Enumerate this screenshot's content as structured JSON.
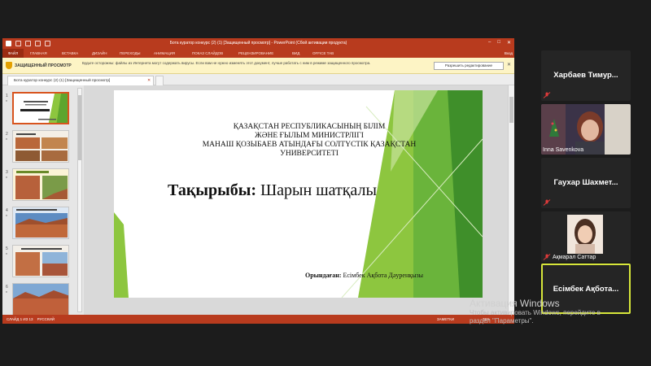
{
  "window": {
    "title": "Бота куратор конкурс (2) (1) [Защищенный просмотр] - PowerPoint (Сбой активации продукта)",
    "file_tab": "ФАЙЛ",
    "tabs": [
      "ГЛАВНАЯ",
      "ВСТАВКА",
      "ДИЗАЙН",
      "ПЕРЕХОДЫ",
      "АНИМАЦИЯ",
      "ПОКАЗ СЛАЙДОВ",
      "РЕЦЕНЗИРОВАНИЕ",
      "ВИД",
      "OFFICE TAB"
    ],
    "user": "Вход"
  },
  "protected_view": {
    "label": "ЗАЩИЩЕННЫЙ ПРОСМОТР",
    "message": "Будьте осторожны: файлы из Интернета могут содержать вирусы. Если вам не нужно изменять этот документ, лучше работать с ним в режиме защищенного просмотра.",
    "enable_button": "Разрешить редактирование"
  },
  "document_tab": "Бота куратор конкурс (2) (1) [Защищенный просмотр]",
  "thumbnails": [
    {
      "num": "1"
    },
    {
      "num": "2"
    },
    {
      "num": "3"
    },
    {
      "num": "4"
    },
    {
      "num": "5"
    },
    {
      "num": "6"
    }
  ],
  "slide": {
    "org_lines": [
      "ҚАЗАҚСТАН РЕСПУБЛИКАСЫНЫҢ БІЛІМ",
      "ЖӘНЕ ҒЫЛЫМ МИНИСТРЛІГІ",
      "МАНАШ ҚОЗЫБАЕВ АТЫНДАҒЫ СОЛТҮСТІК ҚАЗАҚСТАН",
      "УНИВЕРСИТЕТІ"
    ],
    "topic_label": "Тақырыбы:",
    "topic_value": "Шарын шатқалы",
    "author_label": "Орындаған:",
    "author_value": "Есімбек Ақбота Дәуренқызы"
  },
  "statusbar": {
    "slide_info": "СЛАЙД 1 ИЗ 13",
    "language": "РУССКИЙ",
    "notes": "ЗАМЕТКИ",
    "zoom": "76%"
  },
  "participants": [
    {
      "name": "Харбаев Тимур...",
      "muted": true
    },
    {
      "name": "Inna Savenkova",
      "muted": true
    },
    {
      "name": "Гаухар Шахмет...",
      "muted": true
    },
    {
      "name": "Ақмарал Саттар",
      "muted": true
    },
    {
      "name": "Есімбек Ақбота...",
      "muted": false
    }
  ],
  "watermark": {
    "title": "Активация Windows",
    "line1": "Чтобы активировать Windows, перейдите в",
    "line2": "раздел \"Параметры\"."
  },
  "colors": {
    "ppt_accent": "#b83b1e",
    "slide_green": "#8dc63f",
    "active_speaker": "#d7e63a",
    "mic_muted": "#e03a3a"
  }
}
